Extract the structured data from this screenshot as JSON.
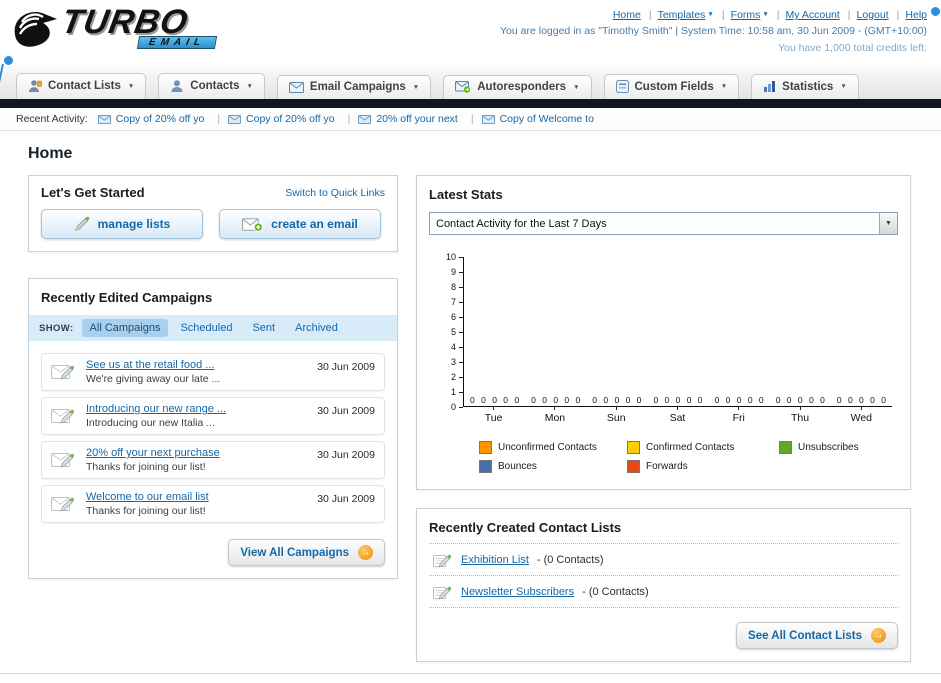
{
  "theme": {
    "link_blue": "#1468a8",
    "accent_orange": "#f08a00",
    "nav_dark_bar": "#12171f"
  },
  "header": {
    "logo_title": "TURBO",
    "logo_subtitle": "EMAIL",
    "nav": [
      {
        "label": "Home"
      },
      {
        "label": "Templates"
      },
      {
        "label": "Forms"
      },
      {
        "label": "My Account"
      },
      {
        "label": "Logout"
      },
      {
        "label": "Help"
      }
    ],
    "login_info": "You are logged in as \"Timothy Smith\" | System Time: 10:58 am, 30 Jun 2009 - (GMT+10:00)",
    "credits_info": "You have 1,000 total credits left."
  },
  "main_nav": {
    "tabs": [
      {
        "label": "Contact Lists",
        "icon": "contact-lists-icon"
      },
      {
        "label": "Contacts",
        "icon": "contacts-icon"
      },
      {
        "label": "Email Campaigns",
        "icon": "email-campaigns-icon"
      },
      {
        "label": "Autoresponders",
        "icon": "autoresponders-icon"
      },
      {
        "label": "Custom Fields",
        "icon": "custom-fields-icon"
      },
      {
        "label": "Statistics",
        "icon": "statistics-icon"
      }
    ]
  },
  "recent_activity": {
    "label": "Recent Activity:",
    "items": [
      {
        "text": "Copy of 20% off yo"
      },
      {
        "text": "Copy of 20% off yo"
      },
      {
        "text": "20% off your next"
      },
      {
        "text": "Copy of Welcome to"
      }
    ]
  },
  "page_title": "Home",
  "get_started": {
    "title": "Let's Get Started",
    "switch_link": "Switch to Quick Links",
    "manage_lists_label": "manage lists",
    "create_email_label": "create an email"
  },
  "campaigns": {
    "title": "Recently Edited Campaigns",
    "show_label": "SHOW:",
    "filters": [
      {
        "label": "All Campaigns",
        "active": true
      },
      {
        "label": "Scheduled",
        "active": false
      },
      {
        "label": "Sent",
        "active": false
      },
      {
        "label": "Archived",
        "active": false
      }
    ],
    "items": [
      {
        "title": "See us at the retail food ...",
        "subtitle": "We're giving away our late ...",
        "date": "30 Jun 2009"
      },
      {
        "title": "Introducing our new range ...",
        "subtitle": "Introducing our new Italia ...",
        "date": "30 Jun 2009"
      },
      {
        "title": "20% off your next purchase",
        "subtitle": "Thanks for joining our list!",
        "date": "30 Jun 2009"
      },
      {
        "title": "Welcome to our email list",
        "subtitle": "Thanks for joining our list!",
        "date": "30 Jun 2009"
      }
    ],
    "view_all_label": "View All Campaigns"
  },
  "latest_stats": {
    "title": "Latest Stats",
    "selector_value": "Contact Activity for the Last 7 Days",
    "zero_group": "0 0 0 0 0",
    "chart_data": {
      "type": "bar",
      "title": "Contact Activity for the Last 7 Days",
      "categories": [
        "Tue",
        "Mon",
        "Sun",
        "Sat",
        "Fri",
        "Thu",
        "Wed"
      ],
      "series": [
        {
          "name": "Unconfirmed Contacts",
          "color": "#ff9400",
          "values": [
            0,
            0,
            0,
            0,
            0,
            0,
            0
          ]
        },
        {
          "name": "Confirmed Contacts",
          "color": "#ffcf00",
          "values": [
            0,
            0,
            0,
            0,
            0,
            0,
            0
          ]
        },
        {
          "name": "Unsubscribes",
          "color": "#64a81c",
          "values": [
            0,
            0,
            0,
            0,
            0,
            0,
            0
          ]
        },
        {
          "name": "Bounces",
          "color": "#4a6da7",
          "values": [
            0,
            0,
            0,
            0,
            0,
            0,
            0
          ]
        },
        {
          "name": "Forwards",
          "color": "#e64a12",
          "values": [
            0,
            0,
            0,
            0,
            0,
            0,
            0
          ]
        }
      ],
      "ylim": [
        0,
        10
      ],
      "yticks": [
        "10",
        "9",
        "8",
        "7",
        "6",
        "5",
        "4",
        "3",
        "2",
        "1",
        "0"
      ],
      "grid": false,
      "legend_position": "bottom"
    }
  },
  "contact_lists": {
    "title": "Recently Created Contact Lists",
    "items": [
      {
        "name": "Exhibition List",
        "suffix": "- (0 Contacts)"
      },
      {
        "name": "Newsletter Subscribers",
        "suffix": "- (0 Contacts)"
      }
    ],
    "see_all_label": "See All Contact Lists"
  }
}
